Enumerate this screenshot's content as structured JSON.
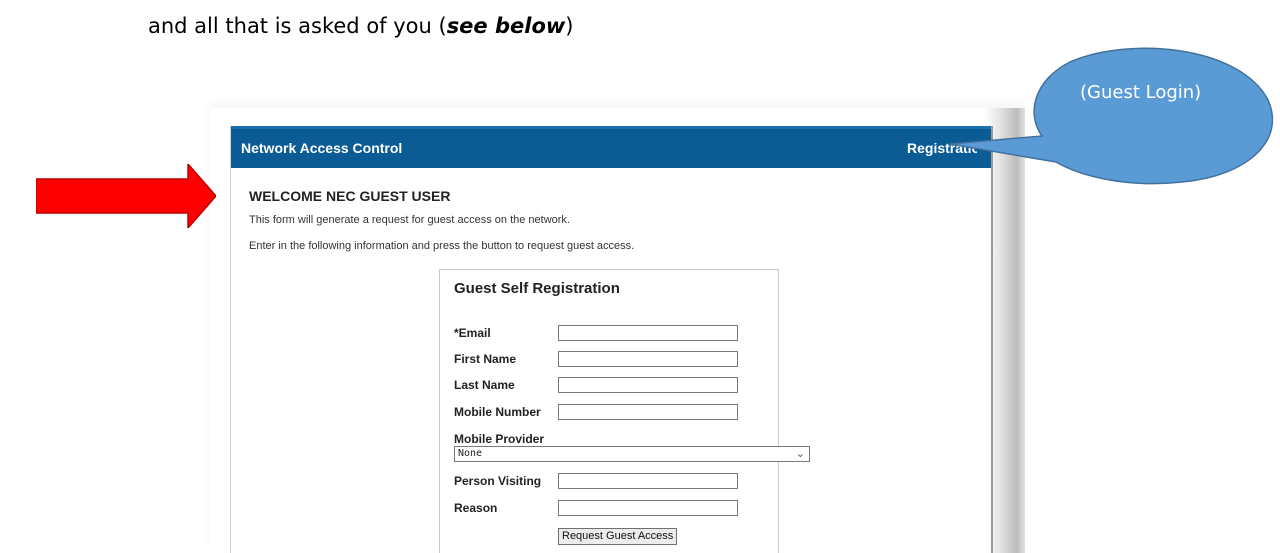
{
  "intro": {
    "text_before": "and all that is asked of you (",
    "emphasis": "see below",
    "text_after": ")"
  },
  "app": {
    "title": "Network Access Control",
    "registration_link": "Registration"
  },
  "page": {
    "heading": "WELCOME NEC GUEST USER",
    "description_1": "This form will generate a request for guest access on the network.",
    "description_2": "Enter in the following information and press the button to request guest access."
  },
  "form": {
    "title": "Guest Self Registration",
    "email_label": "*Email",
    "first_name_label": "First Name",
    "last_name_label": "Last Name",
    "mobile_number_label": "Mobile Number",
    "mobile_provider_label": "Mobile Provider",
    "mobile_provider_value": "None",
    "person_visiting_label": "Person Visiting",
    "reason_label": "Reason",
    "submit_label": "Request Guest Access"
  },
  "annotation": {
    "callout_text": "(Guest Login)",
    "callout_color": "#5b9bd5",
    "arrow_color": "#ff0000"
  },
  "colors": {
    "header_blue": "#0b5b94"
  }
}
